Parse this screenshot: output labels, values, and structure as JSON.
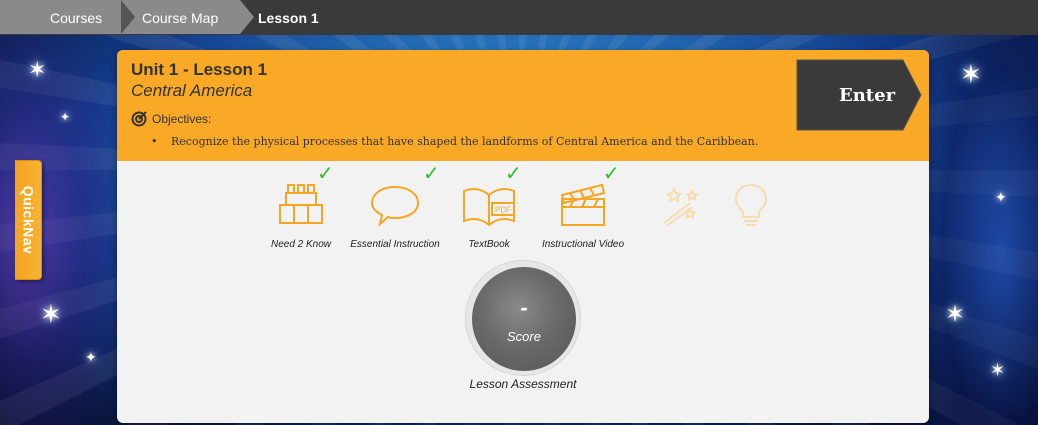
{
  "breadcrumb": {
    "items": [
      "Courses",
      "Course Map",
      "Lesson 1"
    ]
  },
  "quicknav": {
    "label": "QuickNav"
  },
  "lesson": {
    "unit_title": "Unit 1 - Lesson 1",
    "subtitle": "Central America",
    "objectives_label": "Objectives:",
    "objectives": [
      "Recognize the physical processes that have shaped the landforms of Central America and the Caribbean."
    ],
    "enter_label": "Enter"
  },
  "activities": [
    {
      "label": "Need 2 Know",
      "icon": "blocks-icon",
      "completed": true
    },
    {
      "label": "Essential Instruction",
      "icon": "speech-bubble-icon",
      "completed": true
    },
    {
      "label": "TextBook",
      "icon": "book-pdf-icon",
      "completed": true
    },
    {
      "label": "Instructional Video",
      "icon": "clapperboard-icon",
      "completed": true
    },
    {
      "label": "",
      "icon": "magic-wand-icon",
      "completed": false
    },
    {
      "label": "",
      "icon": "lightbulb-icon",
      "completed": false
    }
  ],
  "assessment": {
    "score_value": "-",
    "score_label": "Score",
    "label": "Lesson Assessment"
  },
  "colors": {
    "header_orange": "#f9a926",
    "check_green": "#2ec02e",
    "icon_orange": "#f5a623",
    "icon_faded": "#f6dcae"
  }
}
